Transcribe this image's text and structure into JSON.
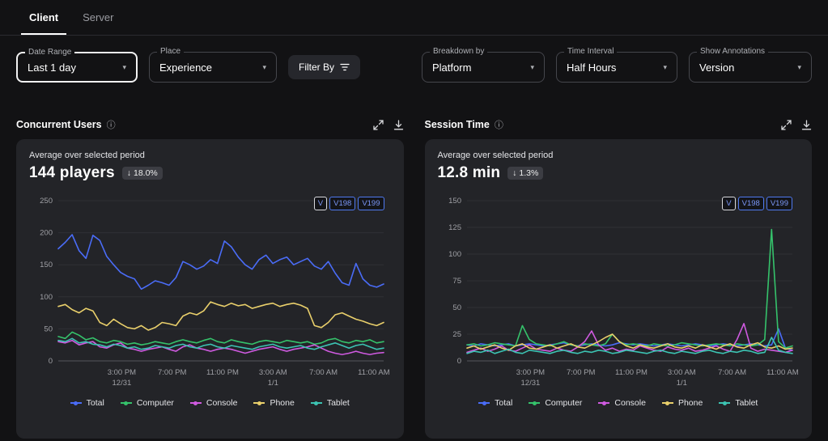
{
  "tabs": [
    {
      "label": "Client"
    },
    {
      "label": "Server"
    }
  ],
  "filters": {
    "date_range": {
      "label": "Date Range",
      "value": "Last 1 day"
    },
    "place": {
      "label": "Place",
      "value": "Experience"
    },
    "filter_by": {
      "label": "Filter By"
    },
    "breakdown": {
      "label": "Breakdown by",
      "value": "Platform"
    },
    "interval": {
      "label": "Time Interval",
      "value": "Half Hours"
    },
    "annotations": {
      "label": "Show Annotations",
      "value": "Version"
    }
  },
  "cards": [
    {
      "title": "Concurrent Users",
      "avg_label": "Average over selected period",
      "value": "144 players",
      "delta_arrow": "↓",
      "delta": "18.0%",
      "annotations": [
        "V",
        "V198",
        "V199"
      ]
    },
    {
      "title": "Session Time",
      "avg_label": "Average over selected period",
      "value": "12.8 min",
      "delta_arrow": "↓",
      "delta": "1.3%",
      "annotations": [
        "V",
        "V198",
        "V199"
      ]
    }
  ],
  "chart_data": [
    {
      "type": "line",
      "title": "Concurrent Users",
      "xlabel": "",
      "ylabel": "players",
      "ylim": [
        0,
        250
      ],
      "yticks": [
        0,
        50,
        100,
        150,
        200,
        250
      ],
      "grid": true,
      "legend_position": "bottom",
      "xticks": [
        {
          "label": "3:00 PM",
          "sub": "12/31",
          "pos": 0.195
        },
        {
          "label": "7:00 PM",
          "pos": 0.35
        },
        {
          "label": "11:00 PM",
          "pos": 0.505
        },
        {
          "label": "3:00 AM",
          "sub": "1/1",
          "pos": 0.66
        },
        {
          "label": "7:00 AM",
          "pos": 0.815
        },
        {
          "label": "11:00 AM",
          "pos": 0.97
        }
      ],
      "series": [
        {
          "name": "Total",
          "color": "#4a6cf7",
          "values": [
            175,
            185,
            197,
            172,
            160,
            196,
            188,
            163,
            150,
            138,
            132,
            128,
            112,
            118,
            125,
            122,
            118,
            130,
            155,
            150,
            143,
            148,
            158,
            152,
            187,
            178,
            162,
            150,
            143,
            158,
            165,
            152,
            158,
            162,
            150,
            155,
            160,
            148,
            143,
            155,
            137,
            122,
            118,
            152,
            128,
            118,
            115,
            120
          ]
        },
        {
          "name": "Computer",
          "color": "#35c26b",
          "values": [
            38,
            35,
            45,
            40,
            33,
            36,
            30,
            28,
            32,
            30,
            26,
            28,
            25,
            27,
            30,
            28,
            26,
            30,
            33,
            30,
            28,
            32,
            35,
            30,
            28,
            33,
            30,
            28,
            26,
            30,
            32,
            30,
            28,
            32,
            30,
            28,
            30,
            26,
            28,
            33,
            35,
            30,
            28,
            32,
            30,
            33,
            28,
            30
          ]
        },
        {
          "name": "Console",
          "color": "#cf5ae0",
          "values": [
            30,
            28,
            32,
            25,
            28,
            30,
            22,
            20,
            25,
            28,
            20,
            18,
            15,
            18,
            20,
            22,
            18,
            15,
            22,
            25,
            20,
            18,
            15,
            18,
            20,
            18,
            15,
            12,
            15,
            18,
            20,
            22,
            18,
            15,
            18,
            20,
            22,
            25,
            20,
            15,
            12,
            10,
            12,
            15,
            12,
            10,
            12,
            13
          ]
        },
        {
          "name": "Phone",
          "color": "#e9cf6b",
          "values": [
            85,
            88,
            80,
            75,
            82,
            78,
            60,
            55,
            65,
            58,
            52,
            50,
            55,
            48,
            52,
            60,
            58,
            55,
            70,
            75,
            72,
            78,
            92,
            88,
            85,
            90,
            86,
            88,
            82,
            85,
            88,
            90,
            85,
            88,
            90,
            87,
            82,
            55,
            52,
            60,
            72,
            75,
            70,
            65,
            62,
            58,
            55,
            60
          ]
        },
        {
          "name": "Tablet",
          "color": "#3cc3b2",
          "values": [
            32,
            30,
            35,
            28,
            30,
            26,
            25,
            22,
            26,
            24,
            20,
            22,
            18,
            20,
            24,
            22,
            20,
            24,
            26,
            22,
            20,
            24,
            26,
            22,
            20,
            24,
            22,
            20,
            18,
            22,
            24,
            26,
            22,
            20,
            22,
            24,
            20,
            18,
            22,
            25,
            28,
            24,
            20,
            24,
            26,
            22,
            18,
            20
          ]
        }
      ]
    },
    {
      "type": "line",
      "title": "Session Time",
      "xlabel": "",
      "ylabel": "min",
      "ylim": [
        0,
        150
      ],
      "yticks": [
        0,
        25,
        50,
        75,
        100,
        125,
        150
      ],
      "grid": true,
      "legend_position": "bottom",
      "xticks": [
        {
          "label": "3:00 PM",
          "sub": "12/31",
          "pos": 0.195
        },
        {
          "label": "7:00 PM",
          "pos": 0.35
        },
        {
          "label": "11:00 PM",
          "pos": 0.505
        },
        {
          "label": "3:00 AM",
          "sub": "1/1",
          "pos": 0.66
        },
        {
          "label": "7:00 AM",
          "pos": 0.815
        },
        {
          "label": "11:00 AM",
          "pos": 0.97
        }
      ],
      "series": [
        {
          "name": "Total",
          "color": "#4a6cf7",
          "values": [
            15,
            14,
            16,
            15,
            14,
            15,
            16,
            14,
            15,
            16,
            15,
            14,
            15,
            16,
            17,
            15,
            14,
            15,
            16,
            15,
            14,
            15,
            17,
            16,
            15,
            16,
            15,
            14,
            15,
            16,
            15,
            14,
            15,
            16,
            15,
            14,
            15,
            16,
            15,
            14,
            15,
            16,
            15,
            14,
            15,
            30,
            12,
            10
          ]
        },
        {
          "name": "Computer",
          "color": "#35c26b",
          "values": [
            15,
            16,
            14,
            15,
            17,
            16,
            15,
            14,
            33,
            20,
            16,
            15,
            14,
            16,
            18,
            15,
            14,
            16,
            15,
            14,
            16,
            25,
            18,
            15,
            16,
            15,
            14,
            16,
            15,
            14,
            15,
            17,
            16,
            15,
            14,
            15,
            16,
            15,
            14,
            16,
            15,
            14,
            15,
            20,
            123,
            18,
            12,
            14
          ]
        },
        {
          "name": "Console",
          "color": "#cf5ae0",
          "values": [
            8,
            10,
            12,
            9,
            11,
            14,
            10,
            9,
            12,
            15,
            11,
            10,
            9,
            12,
            10,
            9,
            13,
            18,
            28,
            15,
            10,
            12,
            9,
            11,
            10,
            14,
            12,
            10,
            9,
            13,
            11,
            10,
            12,
            9,
            10,
            12,
            14,
            11,
            9,
            20,
            35,
            12,
            9,
            11,
            10,
            9,
            8,
            10
          ]
        },
        {
          "name": "Phone",
          "color": "#e9cf6b",
          "values": [
            12,
            14,
            11,
            13,
            15,
            12,
            10,
            14,
            16,
            12,
            11,
            13,
            15,
            12,
            14,
            16,
            13,
            12,
            15,
            18,
            22,
            25,
            18,
            14,
            12,
            15,
            13,
            12,
            14,
            16,
            13,
            12,
            14,
            12,
            15,
            13,
            11,
            14,
            16,
            13,
            12,
            15,
            17,
            13,
            12,
            14,
            11,
            12
          ]
        },
        {
          "name": "Tablet",
          "color": "#3cc3b2",
          "values": [
            7,
            9,
            8,
            10,
            7,
            9,
            11,
            8,
            7,
            10,
            9,
            8,
            7,
            9,
            10,
            8,
            7,
            9,
            8,
            10,
            9,
            7,
            8,
            10,
            9,
            8,
            7,
            9,
            10,
            8,
            7,
            9,
            8,
            7,
            9,
            10,
            8,
            7,
            9,
            8,
            10,
            9,
            7,
            8,
            22,
            10,
            8,
            7
          ]
        }
      ]
    }
  ]
}
